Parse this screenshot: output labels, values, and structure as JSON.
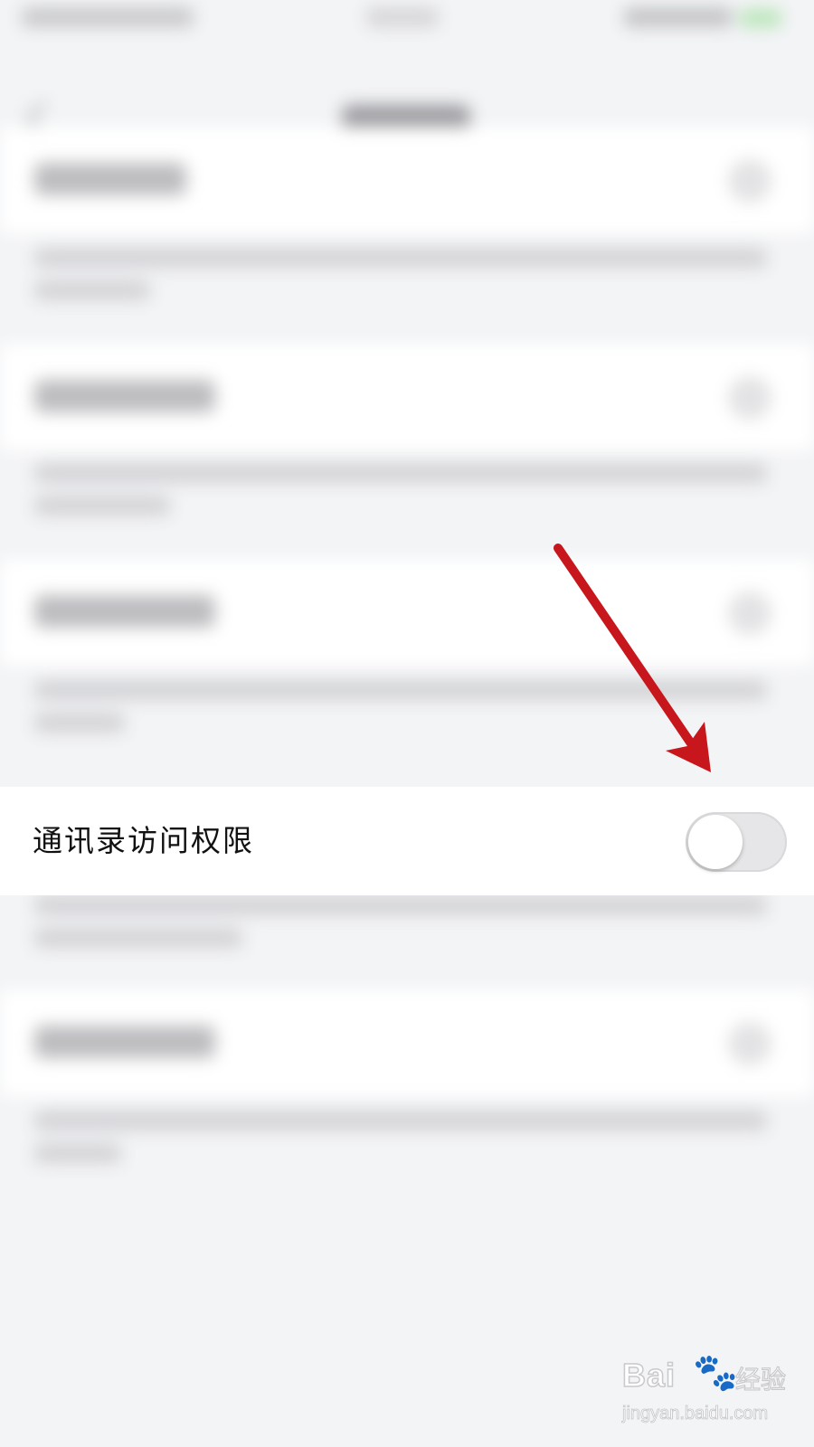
{
  "setting": {
    "label": "通讯录访问权限",
    "toggle_on": false
  },
  "colors": {
    "arrow": "#c8161d",
    "toggle_off": "#e6e6e8",
    "background": "#f3f4f6"
  },
  "watermark": {
    "brand": "Bai",
    "brand_cn": "经验",
    "url": "jingyan.baidu.com"
  }
}
